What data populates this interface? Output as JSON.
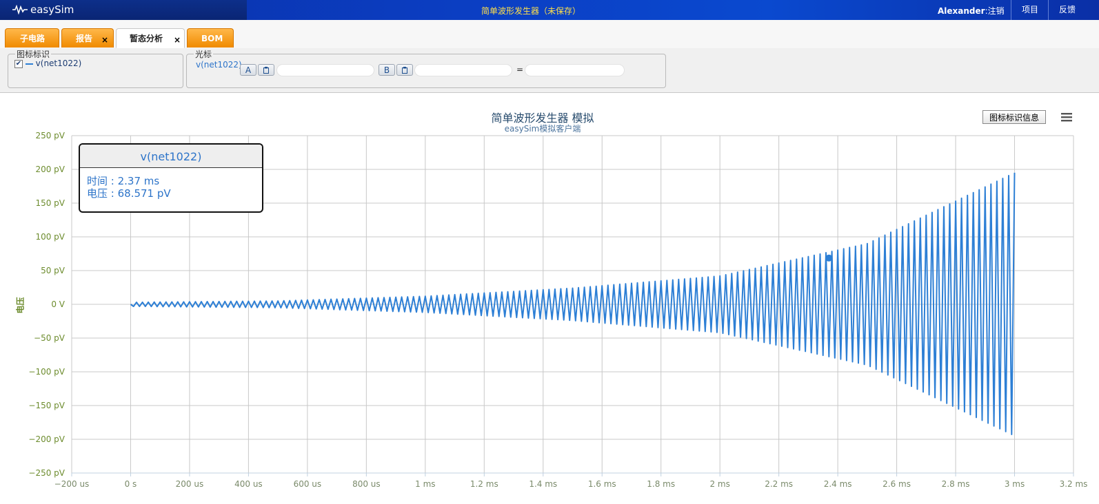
{
  "app": {
    "logo_text": "easySim",
    "doc_title": "简单波形发生器（未保存）"
  },
  "user": {
    "name": "Alexander",
    "sep": ":",
    "logout": "注销"
  },
  "top_links": [
    {
      "label": "项目"
    },
    {
      "label": "反馈"
    }
  ],
  "tabs": [
    {
      "label": "子电路",
      "active": false,
      "closable": false
    },
    {
      "label": "报告",
      "active": false,
      "closable": true
    },
    {
      "label": "暂态分析",
      "active": true,
      "closable": true
    },
    {
      "label": "BOM",
      "active": false,
      "closable": false
    }
  ],
  "legend_panel": {
    "title": "图标标识",
    "series": "v(net1022)",
    "checked": true,
    "close": "×"
  },
  "cursor_panel": {
    "title": "光标",
    "series": "v(net1022)",
    "a_label": "A",
    "b_label": "B",
    "equals": "=",
    "a_value": "",
    "b_value": "",
    "diff_value": ""
  },
  "chart": {
    "title": "简单波形发生器 模拟",
    "subtitle": "easySim模拟客户端",
    "info_button": "图标标识信息",
    "ylabel": "电压"
  },
  "tooltip": {
    "series": "v(net1022)",
    "time_label": "时间",
    "time_value": "2.37 ms",
    "voltage_label": "电压",
    "voltage_value": "68.571 pV"
  },
  "chart_data": {
    "type": "line",
    "title": "简单波形发生器 模拟",
    "subtitle": "easySim模拟客户端",
    "xlabel": "",
    "ylabel": "电压",
    "x_unit": "s",
    "y_unit": "pV",
    "xlim": [
      -0.0002,
      0.0032
    ],
    "ylim": [
      -250,
      250
    ],
    "x_ticks": [
      "−200 us",
      "0 s",
      "200 us",
      "400 us",
      "600 us",
      "800 us",
      "1 ms",
      "1.2 ms",
      "1.4 ms",
      "1.6 ms",
      "1.8 ms",
      "2 ms",
      "2.2 ms",
      "2.4 ms",
      "2.6 ms",
      "2.8 ms",
      "3 ms",
      "3.2 ms"
    ],
    "y_ticks": [
      "250 pV",
      "200 pV",
      "150 pV",
      "100 pV",
      "50 pV",
      "0 V",
      "−50 pV",
      "−100 pV",
      "−150 pV",
      "−200 pV",
      "−250 pV"
    ],
    "grid": true,
    "color": "#2d7fd5",
    "series": [
      {
        "name": "v(net1022)",
        "waveform": "growing oscillation",
        "x_start": 0.0,
        "x_end": 0.003,
        "cycles_per_ms": 50,
        "envelope": [
          {
            "x": 0.0,
            "amp": 3
          },
          {
            "x": 0.0005,
            "amp": 5
          },
          {
            "x": 0.001,
            "amp": 12
          },
          {
            "x": 0.0015,
            "amp": 24
          },
          {
            "x": 0.002,
            "amp": 42
          },
          {
            "x": 0.0025,
            "amp": 90
          },
          {
            "x": 0.003,
            "amp": 195
          }
        ]
      }
    ],
    "highlight": {
      "x": 0.00237,
      "y": 68.571
    }
  },
  "colors": {
    "accent_tab": "#f59200",
    "topbar": "#0a3bbd",
    "series": "#2d7fd5",
    "axis_text": "#6d8c2e",
    "grid": "#c0c0c0"
  }
}
